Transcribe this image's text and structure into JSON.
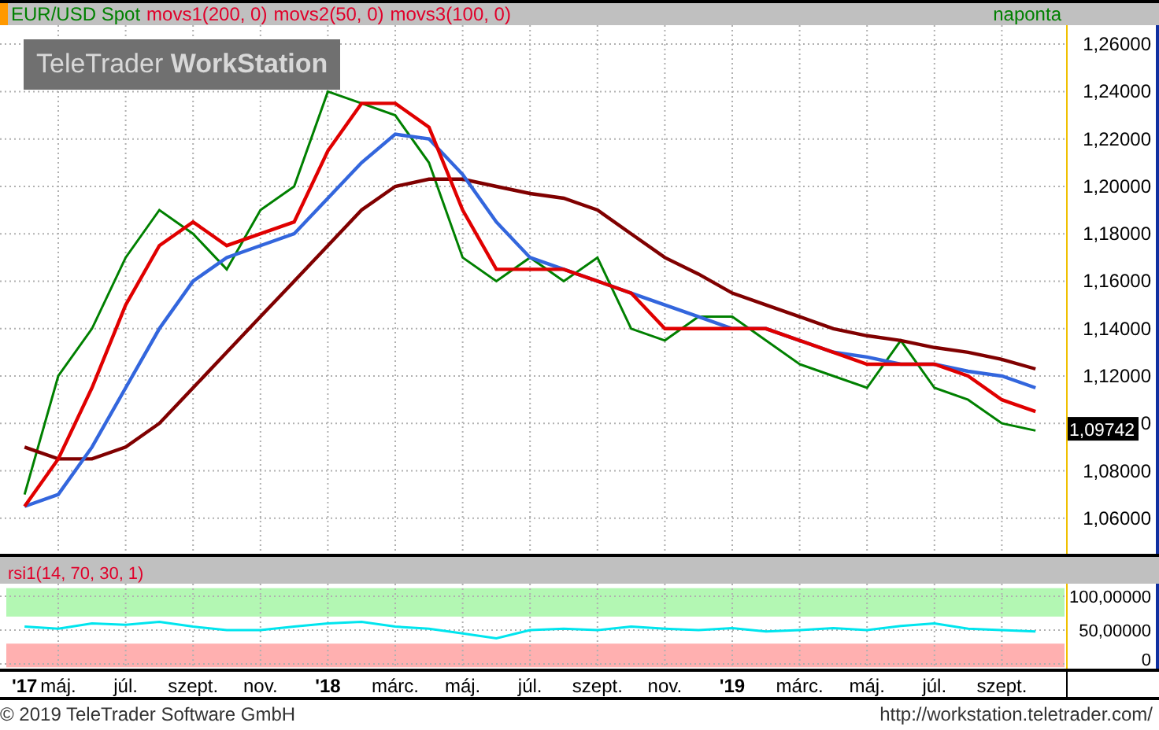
{
  "header": {
    "legend": [
      {
        "text": "EUR/USD Spot",
        "color": "#008000"
      },
      {
        "text": "movs1(200, 0)",
        "color": "#e0002a"
      },
      {
        "text": "movs2(50, 0)",
        "color": "#e0002a"
      },
      {
        "text": "movs3(100, 0)",
        "color": "#e0002a"
      }
    ],
    "interval": "naponta"
  },
  "logo": {
    "text": "TeleTrader ",
    "bold": "WorkStation"
  },
  "price_axis": [
    "1,26000",
    "1,24000",
    "1,22000",
    "1,20000",
    "1,18000",
    "1,16000",
    "1,14000",
    "1,12000",
    "0",
    "1,08000",
    "1,06000"
  ],
  "last_price": "1,09742",
  "rsi_panel": {
    "title": "rsi1(14, 70, 30, 1)",
    "axis": [
      "100,00000",
      "50,00000",
      "0"
    ]
  },
  "x_axis": [
    {
      "label": "'17",
      "year": true
    },
    {
      "label": "máj.",
      "year": false
    },
    {
      "label": "júl.",
      "year": false
    },
    {
      "label": "szept.",
      "year": false
    },
    {
      "label": "nov.",
      "year": false
    },
    {
      "label": "'18",
      "year": true
    },
    {
      "label": "márc.",
      "year": false
    },
    {
      "label": "máj.",
      "year": false
    },
    {
      "label": "júl.",
      "year": false
    },
    {
      "label": "szept.",
      "year": false
    },
    {
      "label": "nov.",
      "year": false
    },
    {
      "label": "'19",
      "year": true
    },
    {
      "label": "márc.",
      "year": false
    },
    {
      "label": "máj.",
      "year": false
    },
    {
      "label": "júl.",
      "year": false
    },
    {
      "label": "szept.",
      "year": false
    }
  ],
  "footer": {
    "copyright": "© 2019 TeleTrader Software GmbH",
    "url": "http://workstation.teletrader.com/"
  }
}
